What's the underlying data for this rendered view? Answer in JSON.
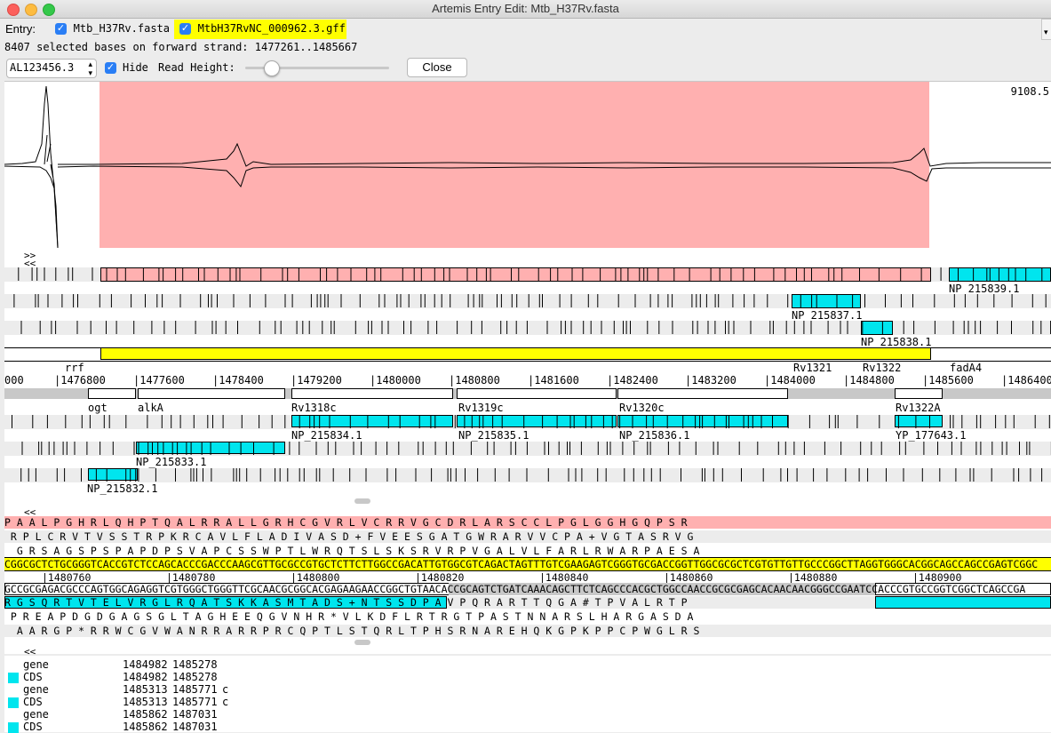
{
  "window": {
    "title": "Artemis Entry Edit: Mtb_H37Rv.fasta"
  },
  "entry_bar": {
    "label": "Entry:",
    "entries": [
      {
        "name": "Mtb_H37Rv.fasta",
        "checked": true,
        "highlighted": false
      },
      {
        "name": "MtbH37RvNC_000962.3.gff",
        "checked": true,
        "highlighted": true
      }
    ]
  },
  "status": {
    "text": "8407 selected bases on forward strand: 1477261..1485667"
  },
  "toolbar": {
    "sequence_select": "AL123456.3",
    "hide_label": "Hide",
    "hide_checked": true,
    "read_height_label": "Read Height:",
    "read_height_fraction": 0.18,
    "close_label": "Close"
  },
  "graph": {
    "max_value": "9108.5"
  },
  "overview": {
    "nav_forward": ">>",
    "nav_back": "<<",
    "ruler_ticks": [
      "000",
      "1476800",
      "1477600",
      "1478400",
      "1479200",
      "1480000",
      "1480800",
      "1481600",
      "1482400",
      "1483200",
      "1484000",
      "1484800",
      "1485600",
      "1486400"
    ],
    "labels": {
      "rrf": "rrf",
      "fadA4": "fadA4",
      "Rv1321": "Rv1321",
      "Rv1322": "Rv1322",
      "ogt": "ogt",
      "alkA": "alkA",
      "Rv1318c": "Rv1318c",
      "Rv1319c": "Rv1319c",
      "Rv1320c": "Rv1320c",
      "Rv1322A": "Rv1322A",
      "NP_215839": "NP_215839.1",
      "NP_215837": "NP_215837.1",
      "NP_215838": "NP_215838.1",
      "NP_215834": "NP_215834.1",
      "NP_215835": "NP_215835.1",
      "NP_215836": "NP_215836.1",
      "YP_177643": "YP_177643.1",
      "NP_215833": "NP_215833.1",
      "NP_215832": "NP_215832.1"
    }
  },
  "sequence": {
    "nav_back": "<<",
    "frame1": "P A A L P G H R L Q H P T Q A L R R A L L G R H C G V R L V C R R V G C D R L A R S C C L P G L G G H G Q P S R",
    "frame2": " R P L C R V T V S S T R P K R C A V L F L A D I V A S D + F V E E S G A T G W R A R V V C P A + V G T A S R V G",
    "frame3": "  G R S A G S P S P A P D P S V A P C S S W P T L W R Q T S L S K S R V R P V G A L V L F A R L R W A R P A E S A",
    "forward_dna": "CGGCGCTCTGCGGGTCACCGTCTCCAGCACCCGACCCAAGCGTTGCGCCGTGCTCTTCTTGGCCGACATTGTGGCGTCAGACTAGTTTGTCGAAGAGTCGGGTGCGACCGGTTGGCGCGCTCGTGTTGTTGCCCGGCTTAGGTGGGCACGGCAGCCAGCCGAGTCGGC",
    "positions": [
      "1480760",
      "1480780",
      "1480800",
      "1480820",
      "1480840",
      "1480860",
      "1480880",
      "1480900"
    ],
    "reverse_dna": "GCCGCGAGACGCCCAGTGGCAGAGGTCGTGGGCTGGGTTCGCAACGCGGCACGAGAAGAACCGGCTGTAACACCGCAGTCTGATCAAACAGCTTCTCAGCCCACGCTGGCCAACCGCGCGAGCACAACAACGGGCCGAATCCACCCGTGCCGGTCGGCTCAGCCGA",
    "frame4": "R G S Q R T V T E L V R G L R Q A T S K K A S M T A D S + N T S S D P A V P Q R A R T T Q G A # T P V A L R T P",
    "frame5": " P R E A P D G D G A G S G L T A G H E E Q G V N H R * V L K D F L R T R G T P A S T N N A R S L H A R G A S D A",
    "frame6": "  A A R G P * R R W C G V W A N R R A R R P R C Q P T L S T Q R L T P H S R N A R E H Q K G P K P P C P W G L R S"
  },
  "feature_list": [
    {
      "key": "gene",
      "start": "1484982",
      "end": "1485278",
      "strand": "",
      "color": ""
    },
    {
      "key": "CDS",
      "start": "1484982",
      "end": "1485278",
      "strand": "",
      "color": "#00e5ee"
    },
    {
      "key": "gene",
      "start": "1485313",
      "end": "1485771",
      "strand": "c",
      "color": ""
    },
    {
      "key": "CDS",
      "start": "1485313",
      "end": "1485771",
      "strand": "c",
      "color": "#00e5ee"
    },
    {
      "key": "gene",
      "start": "1485862",
      "end": "1487031",
      "strand": "",
      "color": ""
    },
    {
      "key": "CDS",
      "start": "1485862",
      "end": "1487031",
      "strand": "",
      "color": "#00e5ee"
    }
  ],
  "colors": {
    "selection": "#ffb0b0",
    "cds": "#00e5ee",
    "gene_highlight": "#ffff00"
  }
}
